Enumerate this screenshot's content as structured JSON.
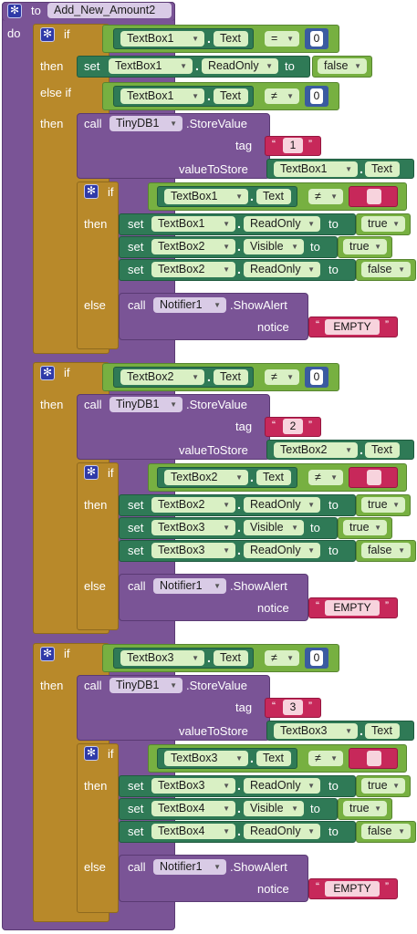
{
  "procedure": {
    "to_label": "to",
    "name": "Add_New_Amount2",
    "do_label": "do"
  },
  "keywords": {
    "if": "if",
    "then": "then",
    "else_if": "else if",
    "else": "else",
    "set": "set",
    "to": "to",
    "call": "call",
    "tag": "tag",
    "value_to_store": "valueToStore",
    "notice": "notice",
    "store_value": ".StoreValue",
    "show_alert": ".ShowAlert",
    "dot": "."
  },
  "first_if": {
    "cond": {
      "component": "TextBox1",
      "prop": "Text",
      "op": "=",
      "value": "0"
    },
    "then": {
      "component": "TextBox1",
      "prop": "ReadOnly",
      "value": "false"
    },
    "elseif_cond": {
      "component": "TextBox1",
      "prop": "Text",
      "op": "≠",
      "value": "0"
    }
  },
  "sections": [
    {
      "db": "TinyDB1",
      "tag": "1",
      "store_comp": "TextBox1",
      "store_prop": "Text",
      "inner_cond": {
        "component": "TextBox1",
        "prop": "Text",
        "op": "≠"
      },
      "sets": [
        {
          "component": "TextBox1",
          "prop": "ReadOnly",
          "value": "true"
        },
        {
          "component": "TextBox2",
          "prop": "Visible",
          "value": "true"
        },
        {
          "component": "TextBox2",
          "prop": "ReadOnly",
          "value": "false"
        }
      ],
      "notifier": "Notifier1",
      "alert": "EMPTY"
    },
    {
      "cond": {
        "component": "TextBox2",
        "prop": "Text",
        "op": "≠",
        "value": "0"
      },
      "db": "TinyDB1",
      "tag": "2",
      "store_comp": "TextBox2",
      "store_prop": "Text",
      "inner_cond": {
        "component": "TextBox2",
        "prop": "Text",
        "op": "≠"
      },
      "sets": [
        {
          "component": "TextBox2",
          "prop": "ReadOnly",
          "value": "true"
        },
        {
          "component": "TextBox3",
          "prop": "Visible",
          "value": "true"
        },
        {
          "component": "TextBox3",
          "prop": "ReadOnly",
          "value": "false"
        }
      ],
      "notifier": "Notifier1",
      "alert": "EMPTY"
    },
    {
      "cond": {
        "component": "TextBox3",
        "prop": "Text",
        "op": "≠",
        "value": "0"
      },
      "db": "TinyDB1",
      "tag": "3",
      "store_comp": "TextBox3",
      "store_prop": "Text",
      "inner_cond": {
        "component": "TextBox3",
        "prop": "Text",
        "op": "≠"
      },
      "sets": [
        {
          "component": "TextBox3",
          "prop": "ReadOnly",
          "value": "true"
        },
        {
          "component": "TextBox4",
          "prop": "Visible",
          "value": "true"
        },
        {
          "component": "TextBox4",
          "prop": "ReadOnly",
          "value": "false"
        }
      ],
      "notifier": "Notifier1",
      "alert": "EMPTY"
    }
  ],
  "colors": {
    "procedure": "#7a5496",
    "control": "#b8892a",
    "logic": "#77b041",
    "component": "#2f7a56",
    "text": "#c7285a"
  }
}
